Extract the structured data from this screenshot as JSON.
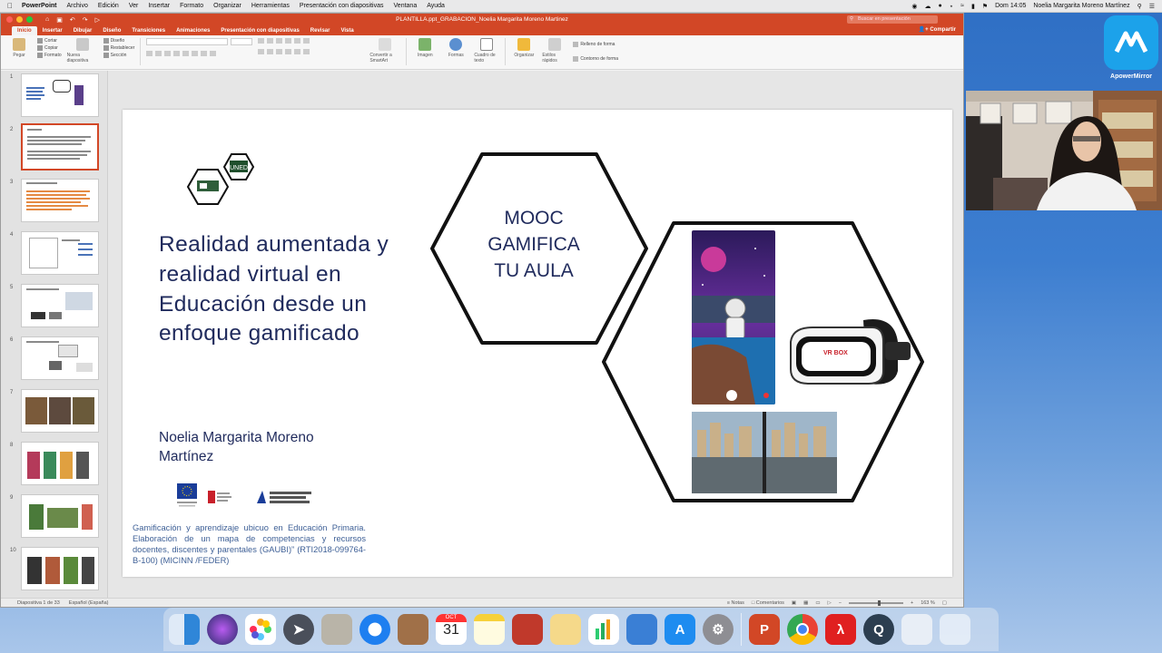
{
  "menubar": {
    "app": "PowerPoint",
    "items": [
      "Archivo",
      "Edición",
      "Ver",
      "Insertar",
      "Formato",
      "Organizar",
      "Herramientas",
      "Presentación con diapositivas",
      "Ventana",
      "Ayuda"
    ],
    "clock": "Dom 14:05",
    "user": "Noelia Margarita Moreno Martínez"
  },
  "window": {
    "title": "PLANTILLA.ppt_GRABACION_Noelia Margarita Moreno Martinez",
    "search_placeholder": "Buscar en presentación",
    "tabs": [
      "Inicio",
      "Insertar",
      "Dibujar",
      "Diseño",
      "Transiciones",
      "Animaciones",
      "Presentación con diapositivas",
      "Revisar",
      "Vista"
    ],
    "active_tab": "Inicio",
    "share_label": "Compartir"
  },
  "ribbon": {
    "paste": "Pegar",
    "cut": "Cortar",
    "copy": "Copiar",
    "format": "Formato",
    "new_slide": "Nueva diapositiva",
    "layout": "Diseño",
    "reset": "Restablecer",
    "section": "Sección",
    "convert_smartart": "Convertir a SmartArt",
    "image": "Imagen",
    "shapes": "Formas",
    "textbox": "Cuadro de texto",
    "arrange": "Organizar",
    "quick_styles": "Estilos rápidos",
    "fill": "Relleno de forma",
    "outline": "Contorno de forma"
  },
  "status": {
    "slide_info": "Diapositiva 1 de 33",
    "language": "Español (España)",
    "notes": "Notas",
    "comments": "Comentarios",
    "zoom": "163 %"
  },
  "thumb_numbers": [
    "1",
    "2",
    "3",
    "4",
    "5",
    "6",
    "7",
    "8",
    "9",
    "10"
  ],
  "slide": {
    "title": "Realidad aumentada y realidad virtual en Educación desde un enfoque gamificado",
    "author": "Noelia Margarita Moreno Martínez",
    "mooc": "MOOC\nGAMIFICA\nTU AULA",
    "funding": "Gamificación y aprendizaje ubicuo en Educación Primaria. Elaboración de un mapa de competencias y recursos docentes, discentes y parentales (GAUBI)” (RTI2018-099764-B-100) (MICINN /FEDER)",
    "uned_label": "UNED",
    "vr_label": "VR BOX"
  },
  "apowermirror": {
    "label": "ApowerMirror"
  },
  "dock": {
    "calendar_month": "OCT",
    "calendar_day": "31"
  },
  "colors": {
    "ppt_red": "#d24726",
    "slide_text": "#1f2a5c",
    "funding_text": "#3d5f96"
  }
}
